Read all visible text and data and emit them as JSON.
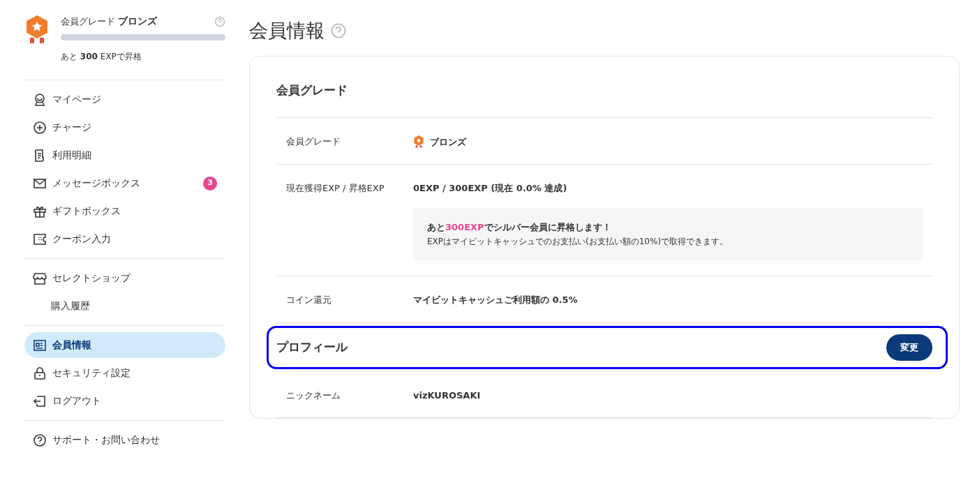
{
  "sidebar": {
    "grade": {
      "label": "会員グレード",
      "name": "ブロンズ",
      "level": 0,
      "remaining": "あと **300** EXPで昇格"
    },
    "groups": [
      [
        {
          "label": "マイページ",
          "selected": false
        },
        {
          "label": "チャージ",
          "selected": false
        },
        {
          "label": "利用明細",
          "selected": false
        },
        {
          "label": "メッセージボックス",
          "selected": false,
          "badge": "3"
        },
        {
          "label": "ギフトボックス",
          "selected": false
        },
        {
          "label": "クーポン入力",
          "selected": false
        }
      ],
      [
        {
          "label": "セレクトショップ",
          "selected": false
        },
        {
          "label": "購入履歴",
          "selected": false,
          "kind": "sub"
        }
      ],
      [
        {
          "label": "会員情報",
          "selected": true
        },
        {
          "label": "セキュリティ設定",
          "selected": false
        },
        {
          "label": "ログアウト",
          "selected": false
        }
      ],
      [
        {
          "label": "サポート・お問い合わせ",
          "selected": false
        }
      ]
    ]
  },
  "main": {
    "title": "会員情報",
    "sections": [
      {
        "heading": "会員グレード",
        "highlighted": false,
        "rows": [
          {
            "label": "会員グレード",
            "value": "ブロンズ",
            "kind": "grade"
          },
          {
            "label": "現在獲得EXP / 昇格EXP",
            "value": "0EXP / 300EXP (現在 0.0% 達成)",
            "note": {
              "headline": [
                {
                  "text": "あと",
                  "accent": false
                },
                {
                  "text": "300EXP",
                  "accent": true
                },
                {
                  "text": "でシルバー会員に昇格します！",
                  "accent": false
                }
              ],
              "text": "EXPはマイビットキャッシュでのお支払い(お支払い額の10%)で取得できます。"
            }
          },
          {
            "label": "コイン還元",
            "value": "マイビットキャッシュご利用額の 0.5%"
          }
        ]
      },
      {
        "heading": "プロフィール",
        "button": "変更",
        "highlighted": true,
        "rows": [
          {
            "label": "ニックネーム",
            "value": "vizKUROSAKI"
          }
        ]
      }
    ]
  }
}
